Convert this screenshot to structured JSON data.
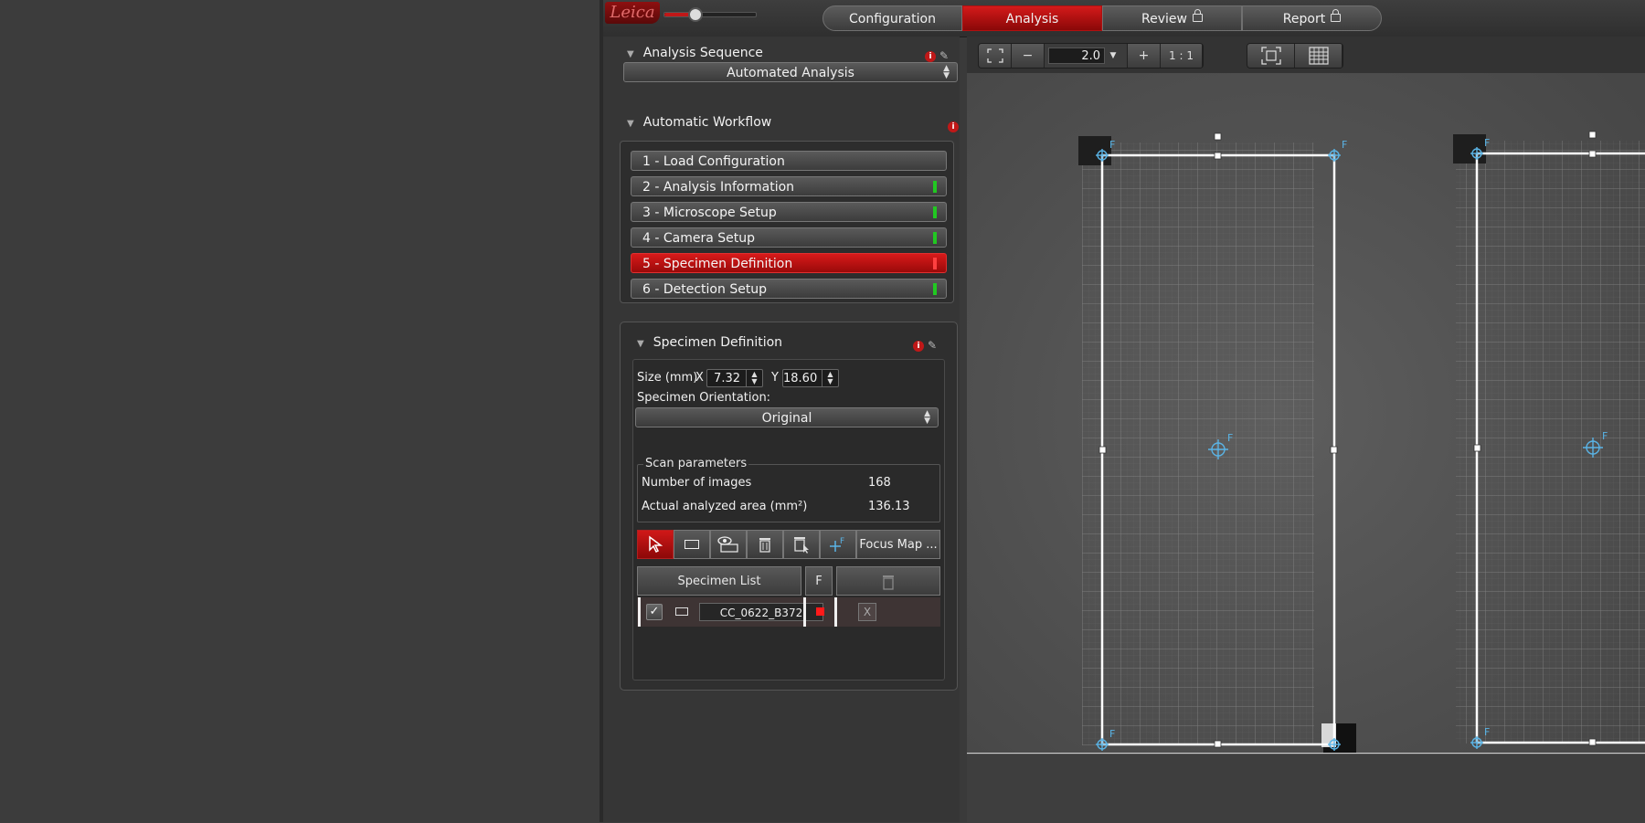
{
  "workflow_steps": [
    {
      "label": "Configuration",
      "locked": false,
      "active": false
    },
    {
      "label": "Analysis",
      "locked": false,
      "active": true
    },
    {
      "label": "Review",
      "locked": true,
      "active": false
    },
    {
      "label": "Report",
      "locked": true,
      "active": false
    }
  ],
  "logo_text": "Leica",
  "analysis_sequence": {
    "title": "Analysis Sequence",
    "selected": "Automated Analysis"
  },
  "automatic_workflow": {
    "title": "Automatic Workflow",
    "items": [
      {
        "label": "1 - Load Configuration",
        "status": "none"
      },
      {
        "label": "2 - Analysis Information",
        "status": "ok"
      },
      {
        "label": "3 - Microscope Setup",
        "status": "ok"
      },
      {
        "label": "4 - Camera Setup",
        "status": "ok"
      },
      {
        "label": "5 - Specimen Definition",
        "status": "active"
      },
      {
        "label": "6 - Detection Setup",
        "status": "ok"
      }
    ]
  },
  "specimen_definition": {
    "title": "Specimen Definition",
    "size_label": "Size (mm)",
    "x_label": "X",
    "x_value": "7.32",
    "y_label": "Y",
    "y_value": "18.60",
    "orientation_label": "Specimen Orientation:",
    "orientation_selected": "Original",
    "scan_parameters": {
      "title": "Scan parameters",
      "images_label": "Number of images",
      "images_value": "168",
      "area_label": "Actual analyzed area (mm²)",
      "area_value": "136.13"
    },
    "toolbar": {
      "focus_map_label": "Focus Map ..."
    },
    "specimen_list": {
      "header": "Specimen List",
      "f_header": "F",
      "rows": [
        {
          "name": "CC_0622_B372",
          "checked": true,
          "remove_label": "X"
        }
      ]
    }
  },
  "image_toolbar": {
    "zoom_minus": "−",
    "zoom_value": "2.0",
    "zoom_plus": "+",
    "one_to_one": "1 : 1"
  },
  "canvas": {
    "focus_marker_label": "F"
  },
  "colors": {
    "accent_red": "#c01818",
    "status_green": "#21c821",
    "overlay_blue": "#5ab4e6"
  }
}
